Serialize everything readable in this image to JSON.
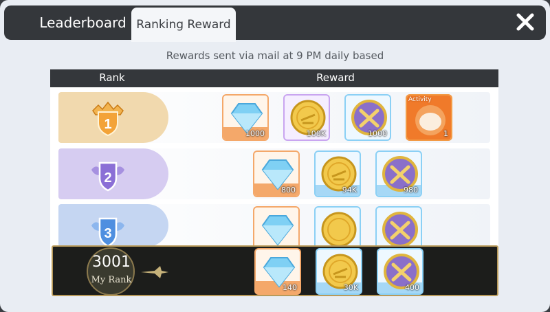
{
  "tabs": [
    {
      "label": "Leaderboard",
      "active": false
    },
    {
      "label": "Ranking Reward",
      "active": true
    }
  ],
  "subtitle": "Rewards sent via mail at 9 PM daily based",
  "table": {
    "rank_header": "Rank",
    "reward_header": "Reward"
  },
  "rows": [
    {
      "rank": "1",
      "badge_color": "#e8a23a",
      "rewards": [
        {
          "icon": "diamond-icon",
          "qty": "1000"
        },
        {
          "icon": "gold-coin-icon",
          "qty": "100K"
        },
        {
          "icon": "sword-token-icon",
          "qty": "1000"
        },
        {
          "icon": "activity-item-icon",
          "label": "Activity",
          "qty": "1"
        }
      ]
    },
    {
      "rank": "2",
      "badge_color": "#8b6fd6",
      "rewards": [
        {
          "icon": "diamond-icon",
          "qty": "800"
        },
        {
          "icon": "gold-coin-icon",
          "qty": "94K"
        },
        {
          "icon": "sword-token-icon",
          "qty": "980"
        }
      ]
    },
    {
      "rank": "3",
      "badge_color": "#4f8fe0",
      "rewards": [
        {
          "icon": "diamond-icon",
          "qty": ""
        },
        {
          "icon": "gold-coin-icon",
          "qty": ""
        },
        {
          "icon": "sword-token-icon",
          "qty": ""
        }
      ]
    }
  ],
  "my_rank": {
    "number": "3001",
    "label": "My Rank",
    "rewards": [
      {
        "icon": "diamond-icon",
        "qty": "140"
      },
      {
        "icon": "gold-coin-icon",
        "qty": "30K"
      },
      {
        "icon": "sword-token-icon",
        "qty": "400"
      }
    ]
  }
}
